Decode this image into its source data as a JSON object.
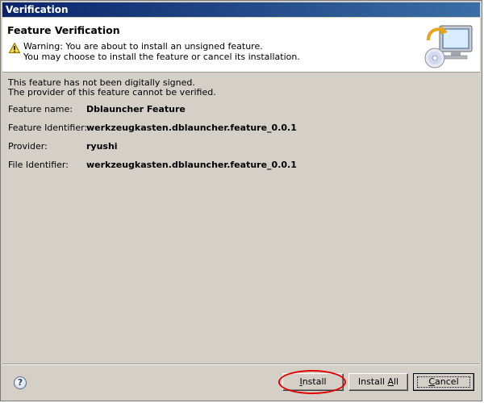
{
  "window": {
    "title": "Verification"
  },
  "header": {
    "title": "Feature Verification",
    "warning_line1": "Warning: You are about to install an unsigned feature.",
    "warning_line2": "You may choose to install the feature or cancel its installation.",
    "warning_icon": "warning-triangle-icon",
    "wizard_icon": "install-computer-icon"
  },
  "body": {
    "message_line1": "This feature has not been digitally signed.",
    "message_line2": "The provider of this feature cannot be verified.",
    "fields": [
      {
        "label": "Feature name:",
        "value": "Dblauncher Feature"
      },
      {
        "label": "Feature Identifier:",
        "value": "werkzeugkasten.dblauncher.feature_0.0.1"
      },
      {
        "label": "Provider:",
        "value": "ryushi"
      },
      {
        "label": "File Identifier:",
        "value": "werkzeugkasten.dblauncher.feature_0.0.1"
      }
    ]
  },
  "footer": {
    "help_icon": "question-mark-icon",
    "install": {
      "mnemonic": "I",
      "rest": "nstall"
    },
    "install_all": {
      "pre": "Install ",
      "mnemonic": "A",
      "rest": "ll"
    },
    "cancel": {
      "mnemonic": "C",
      "rest": "ancel"
    },
    "annotation_color": "#e00000"
  }
}
